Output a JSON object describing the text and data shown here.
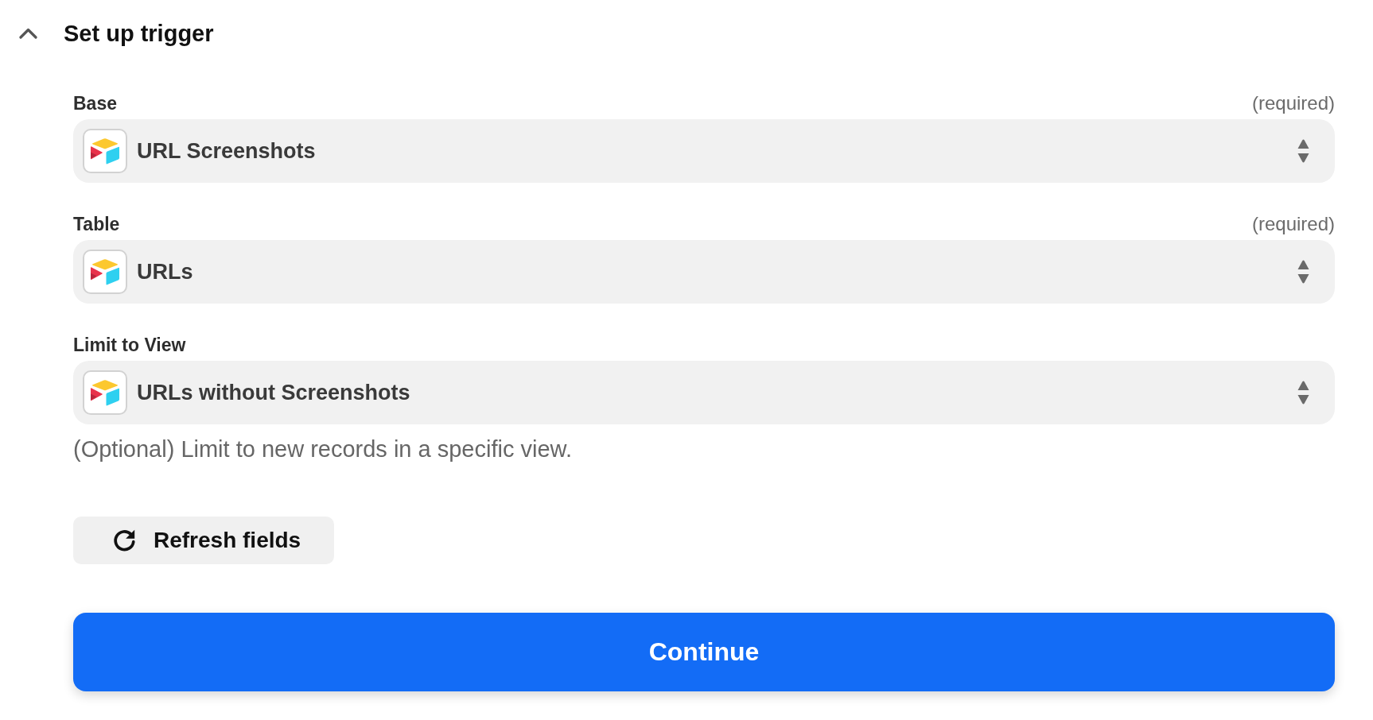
{
  "section": {
    "title": "Set up trigger",
    "expanded": true
  },
  "fields": [
    {
      "label": "Base",
      "note": "(required)",
      "value": "URL Screenshots"
    },
    {
      "label": "Table",
      "note": "(required)",
      "value": "URLs"
    },
    {
      "label": "Limit to View",
      "value": "URLs without Screenshots",
      "help": "(Optional) Limit to new records in a specific view."
    }
  ],
  "buttons": [
    {
      "kind": "secondary",
      "label": "Refresh fields"
    },
    {
      "kind": "primary",
      "label": "Continue"
    }
  ]
}
